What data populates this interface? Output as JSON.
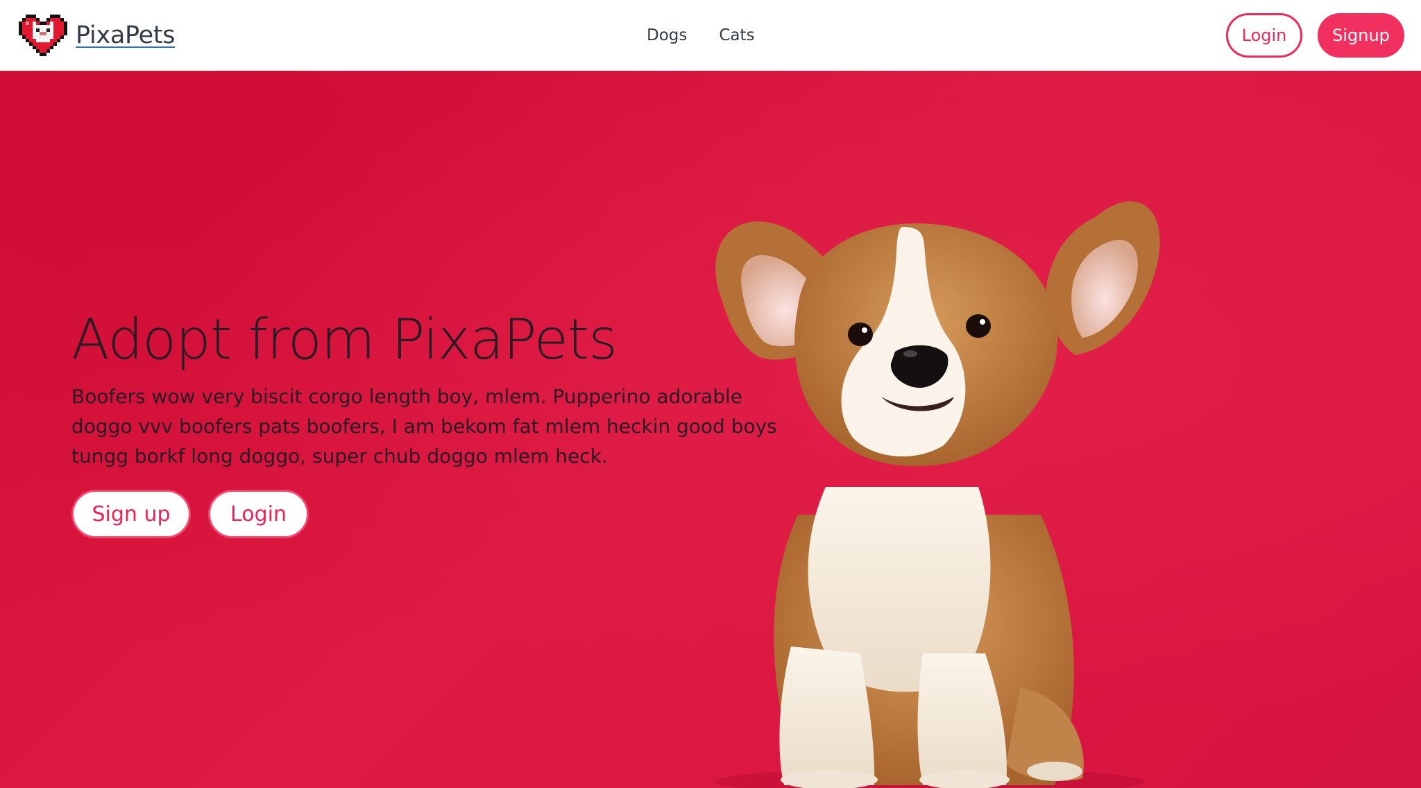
{
  "header": {
    "brand_name": "PixaPets",
    "nav": [
      {
        "label": "Dogs"
      },
      {
        "label": "Cats"
      }
    ],
    "login_label": "Login",
    "signup_label": "Signup"
  },
  "hero": {
    "title": "Adopt from PixaPets",
    "description": "Boofers wow very biscit corgo length boy, mlem. Pupperino adorable doggo vvv boofers pats boofers, I am bekom fat mlem heckin good boys tungg borkf long doggo, super chub doggo mlem heck.",
    "signup_label": "Sign up",
    "login_label": "Login"
  },
  "colors": {
    "accent": "#f0275a",
    "hero_background": "#da173f",
    "header_background": "#ffffff",
    "text_dark": "#2a1b24"
  },
  "icons": {
    "logo": "pixel-heart-cat-logo-icon"
  }
}
